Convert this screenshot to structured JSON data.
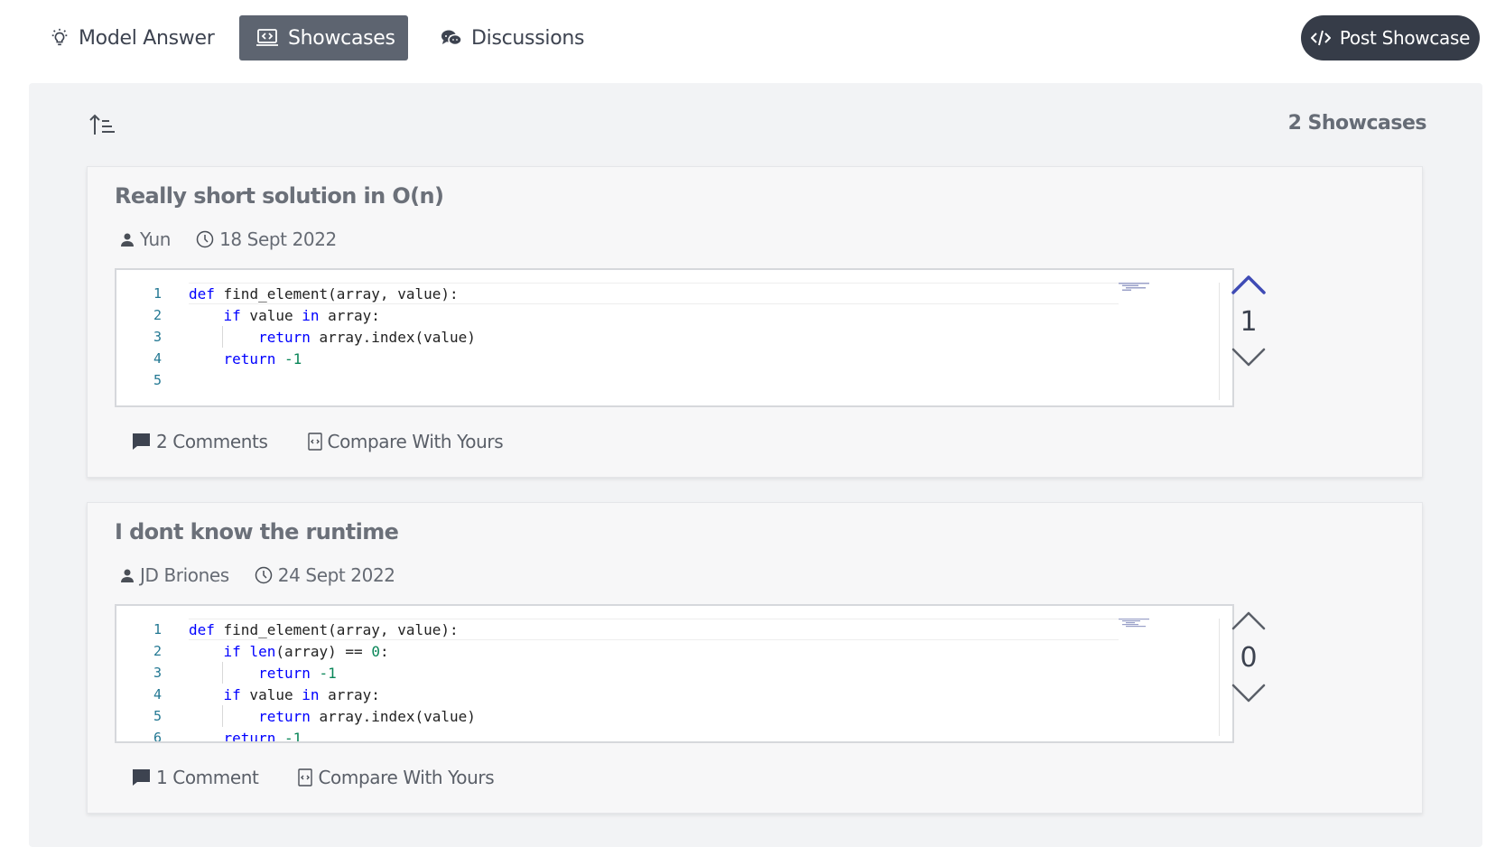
{
  "tabs": [
    {
      "label": "Model Answer",
      "icon": "lightbulb-icon",
      "active": false
    },
    {
      "label": "Showcases",
      "icon": "laptop-code-icon",
      "active": true
    },
    {
      "label": "Discussions",
      "icon": "chat-bubbles-icon",
      "active": false
    }
  ],
  "post_button": {
    "label": "Post Showcase",
    "icon": "code-icon"
  },
  "toolbar": {
    "sort_icon": "sort-ascending-icon",
    "count_label": "2 Showcases"
  },
  "colors": {
    "accent": "#3f4bb5",
    "active_tab": "#5d6470",
    "post_button": "#363c48",
    "panel": "#f2f3f5"
  },
  "showcases": [
    {
      "title": "Really short solution in O(n)",
      "author": "Yun",
      "date": "18 Sept 2022",
      "code_lines": [
        {
          "n": "1"
        },
        {
          "n": "2"
        },
        {
          "n": "3"
        },
        {
          "n": "4"
        },
        {
          "n": "5"
        }
      ],
      "comments_label": "2 Comments",
      "compare_label": "Compare With Yours",
      "score": "1",
      "upvoted": true
    },
    {
      "title": "I dont know the runtime",
      "author": "JD Briones",
      "date": "24 Sept 2022",
      "code_lines": [
        {
          "n": "1"
        },
        {
          "n": "2"
        },
        {
          "n": "3"
        },
        {
          "n": "4"
        },
        {
          "n": "5"
        },
        {
          "n": "6"
        }
      ],
      "comments_label": "1 Comment",
      "compare_label": "Compare With Yours",
      "score": "0",
      "upvoted": false
    }
  ]
}
